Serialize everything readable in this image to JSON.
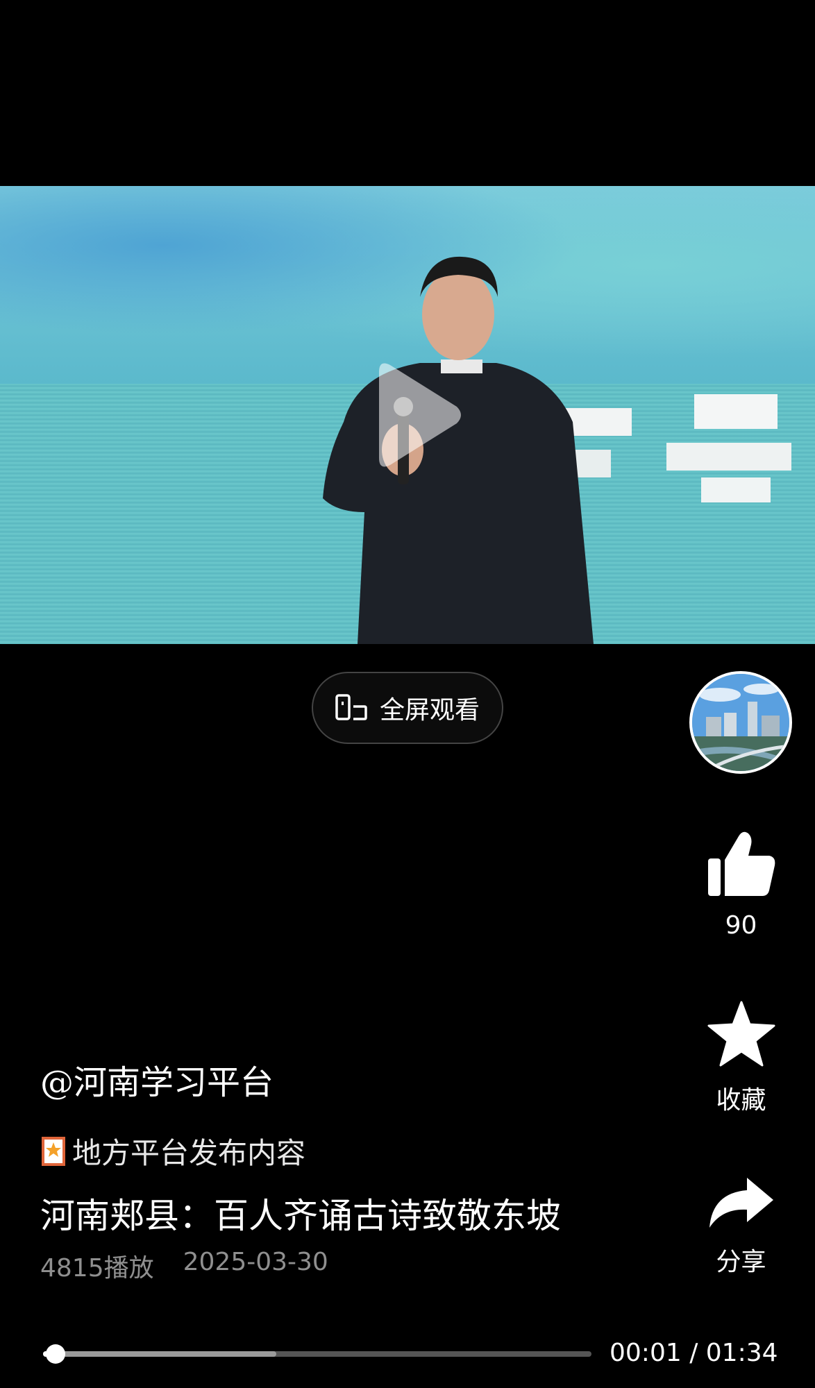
{
  "player": {
    "fullscreen_label": "全屏观看",
    "current_time": "00:01",
    "duration": "01:34",
    "time_separator": " / ",
    "played_fraction": 0.023,
    "buffered_fraction": 0.425
  },
  "actions": {
    "like_count": "90",
    "favorite_label": "收藏",
    "share_label": "分享"
  },
  "post": {
    "author": "@河南学习平台",
    "source_label": "地方平台发布内容",
    "title": "河南郏县：百人齐诵古诗致敬东坡",
    "plays": "4815播放",
    "date": "2025-03-30"
  },
  "icons": {
    "fullscreen": "phone-rotate-icon",
    "like": "thumbs-up-icon",
    "favorite": "star-icon",
    "share": "share-arrow-icon",
    "source": "badge-star-icon",
    "play": "play-icon"
  },
  "colors": {
    "background": "#000000",
    "meta_text": "#8f8f8f",
    "source_badge": "#e0653a"
  }
}
